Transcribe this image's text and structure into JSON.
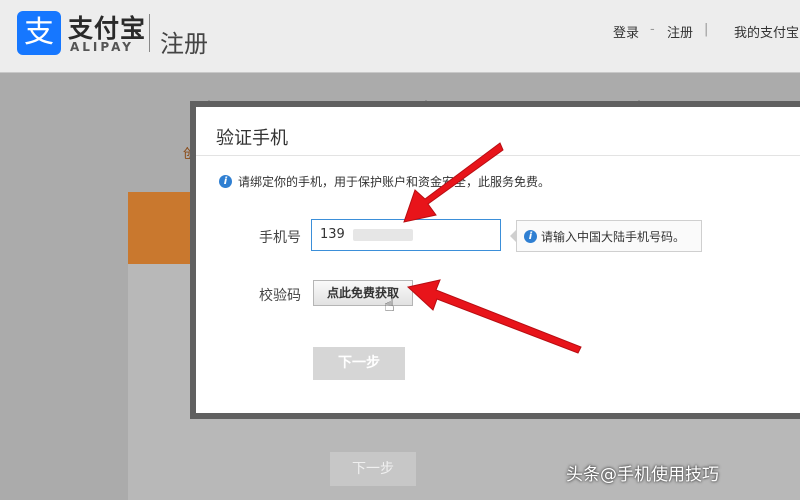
{
  "header": {
    "logo_glyph": "支",
    "logo_cn": "支付宝",
    "logo_en": "ALIPAY",
    "page_name": "注册",
    "nav": {
      "login": "登录",
      "sep1": "-",
      "register": "注册",
      "sep2": "|",
      "my_alipay": "我的支付宝"
    }
  },
  "background": {
    "step_text": "创",
    "next_label": "下一步"
  },
  "modal": {
    "title": "验证手机",
    "notice": "请绑定你的手机，用于保护账户和资金安全，此服务免费。",
    "phone_label": "手机号",
    "phone_value": "139",
    "phone_hint": "请输入中国大陆手机号码。",
    "code_label": "校验码",
    "get_code_label": "点此免费获取",
    "next_label": "下一步",
    "info_glyph": "i"
  },
  "colors": {
    "brand": "#1677ff",
    "arrow": "#e8141a",
    "info": "#2f7fd2"
  },
  "watermark": "头条@手机使用技巧"
}
